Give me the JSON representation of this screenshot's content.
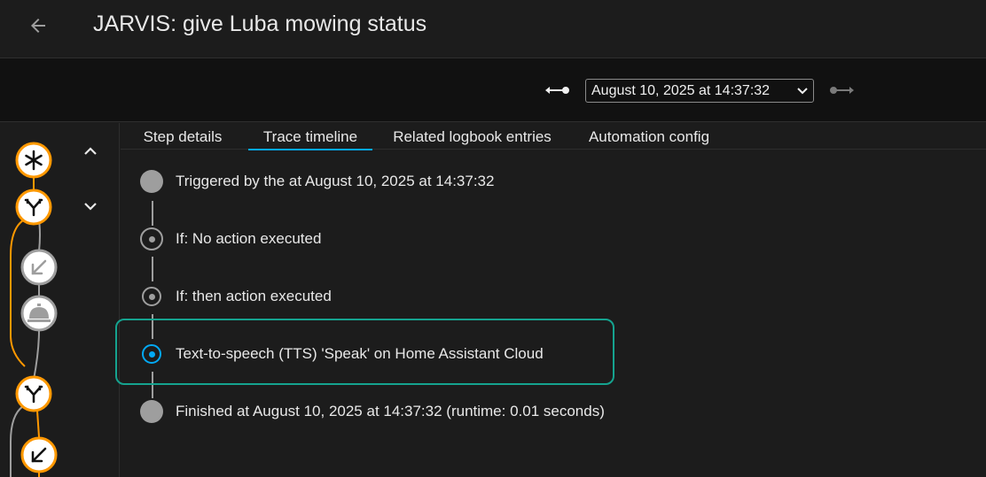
{
  "header": {
    "title": "JARVIS: give Luba mowing status",
    "back_icon": "arrow-left-icon"
  },
  "toolbar": {
    "selected_trace": "August 10, 2025 at 14:37:32",
    "prev_icon": "newer-trace-icon",
    "next_icon": "older-trace-icon"
  },
  "tabs": [
    {
      "label": "Step details",
      "active": false
    },
    {
      "label": "Trace timeline",
      "active": true
    },
    {
      "label": "Related logbook entries",
      "active": false
    },
    {
      "label": "Automation config",
      "active": false
    }
  ],
  "timeline": [
    {
      "text": "Triggered by the at August 10, 2025 at 14:37:32",
      "marker": "filled"
    },
    {
      "text": "If: No action executed",
      "marker": "ring"
    },
    {
      "text": "If: then action executed",
      "marker": "ring"
    },
    {
      "text": "Text-to-speech (TTS) 'Speak' on Home Assistant Cloud",
      "marker": "ring-active"
    },
    {
      "text": "Finished at August 10, 2025 at 14:37:32 (runtime: 0.01 seconds)",
      "marker": "filled"
    }
  ],
  "graph": {
    "nodes": [
      "trigger-node",
      "condition-node",
      "action-node",
      "service-node",
      "condition-node",
      "action-node"
    ],
    "active_color": "#ff9800",
    "inactive_color": "#9e9e9e"
  },
  "colors": {
    "accent": "#03a9f4",
    "highlight": "#15a38f",
    "path": "#ff9800"
  }
}
